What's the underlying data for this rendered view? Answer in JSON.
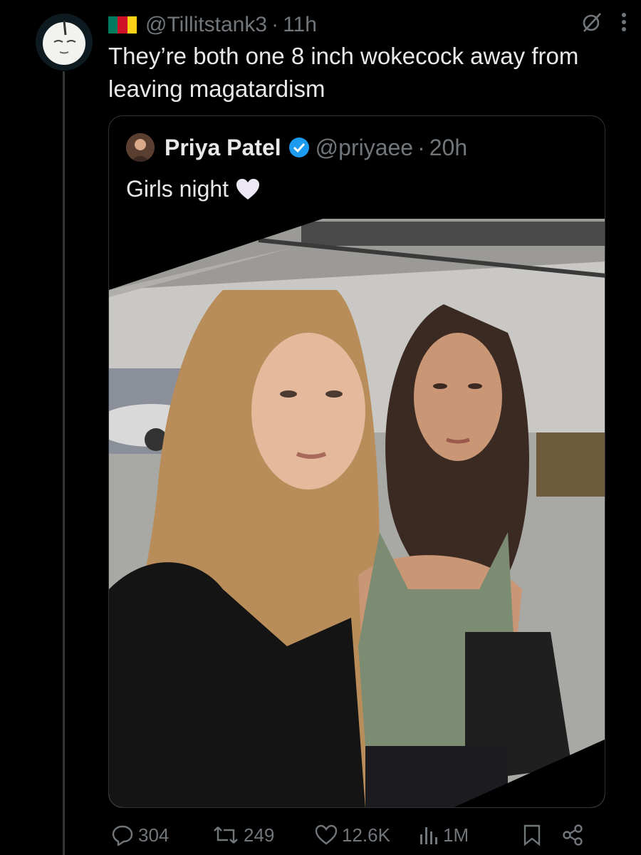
{
  "post": {
    "handle": "@Tillitstank3",
    "separator": "·",
    "time": "11h",
    "text": "They’re both one 8 inch wokecock away from leaving magatardism"
  },
  "quote": {
    "name": "Priya Patel",
    "handle": "@priyaee",
    "separator": "·",
    "time": "20h",
    "text": "Girls night"
  },
  "actions": {
    "replies": "304",
    "reposts": "249",
    "likes": "12.6K",
    "views": "1M"
  },
  "icons": {
    "flag": "cameroon-flag-icon",
    "grok": "grok-icon",
    "more": "more-dots-icon",
    "verified": "verified-badge-icon",
    "emoji": "white-heart-emoji",
    "reply": "reply-icon",
    "repost": "repost-icon",
    "like": "heart-icon",
    "views": "views-icon",
    "bookmark": "bookmark-icon",
    "share": "share-icon"
  },
  "colors": {
    "background": "#000000",
    "text": "#e7e9ea",
    "secondary": "#71767b",
    "border": "#2f3336",
    "verified": "#1d9bf0"
  }
}
